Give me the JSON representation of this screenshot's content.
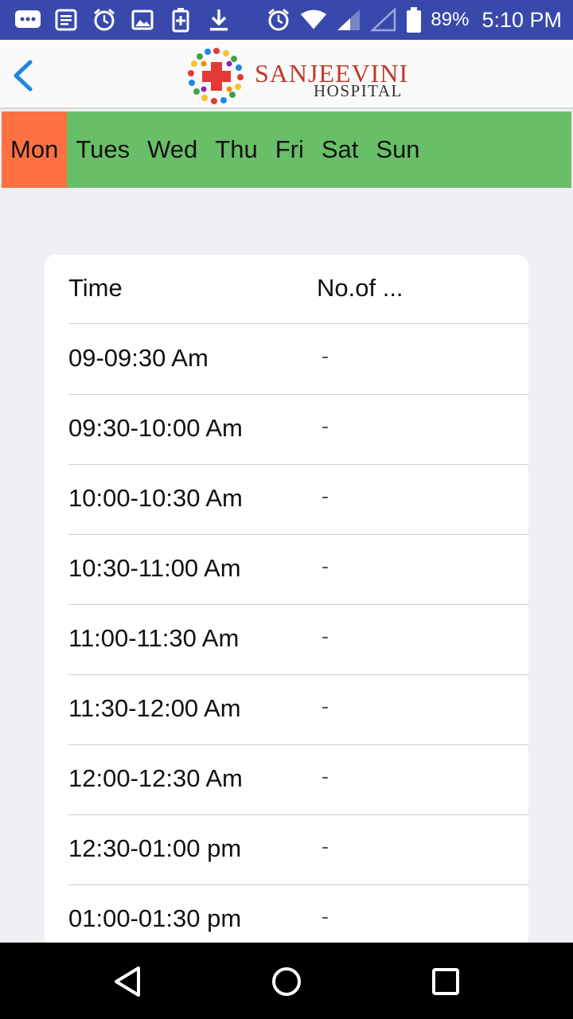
{
  "status_bar": {
    "battery": "89%",
    "time": "5:10 PM",
    "icons": [
      "chat-icon",
      "news-icon",
      "alarm-icon",
      "image-icon",
      "battery-saver-icon",
      "download-icon",
      "alarm-icon",
      "wifi-icon",
      "signal-icon",
      "signal-empty-icon",
      "battery-icon"
    ]
  },
  "header": {
    "logo_name": "SANJEEVINI",
    "logo_sub": "HOSPITAL",
    "back_icon": "chevron-left-icon"
  },
  "tabs": [
    {
      "label": "Mon",
      "active": true
    },
    {
      "label": "Tues",
      "active": false
    },
    {
      "label": "Wed",
      "active": false
    },
    {
      "label": "Thu",
      "active": false
    },
    {
      "label": "Fri",
      "active": false
    },
    {
      "label": "Sat",
      "active": false
    },
    {
      "label": "Sun",
      "active": false
    }
  ],
  "table": {
    "headers": {
      "time": "Time",
      "count": "No.of ..."
    },
    "rows": [
      {
        "time": "09-09:30 Am",
        "count": "-"
      },
      {
        "time": "09:30-10:00 Am",
        "count": "-"
      },
      {
        "time": "10:00-10:30 Am",
        "count": "-"
      },
      {
        "time": "10:30-11:00 Am",
        "count": "-"
      },
      {
        "time": "11:00-11:30 Am",
        "count": "-"
      },
      {
        "time": "11:30-12:00 Am",
        "count": "-"
      },
      {
        "time": "12:00-12:30 Am",
        "count": "-"
      },
      {
        "time": "12:30-01:00 pm",
        "count": "-"
      },
      {
        "time": "01:00-01:30 pm",
        "count": "-"
      }
    ]
  },
  "nav": {
    "back": "nav-back-icon",
    "home": "nav-home-icon",
    "recents": "nav-recents-icon"
  },
  "colors": {
    "status_bar": "#3949ab",
    "tabs_bg": "#69bf68",
    "active_tab": "#ff7043",
    "back": "#1e88e5"
  }
}
